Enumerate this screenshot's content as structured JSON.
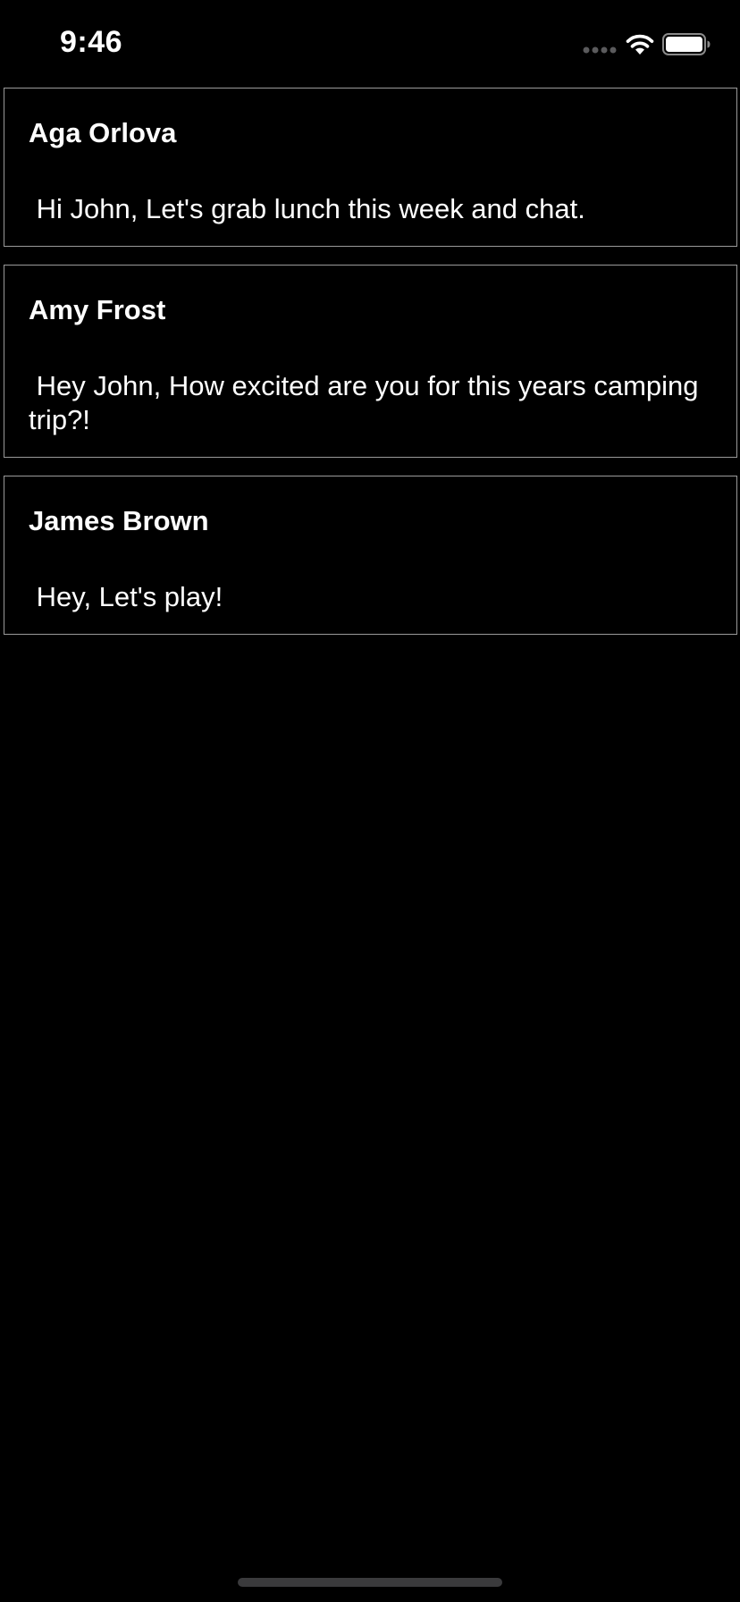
{
  "status_bar": {
    "time": "9:46",
    "icons": [
      "signal-icon",
      "wifi-icon",
      "battery-icon"
    ]
  },
  "messages": [
    {
      "sender": "Aga Orlova",
      "text": " Hi John, Let's grab lunch this week and chat."
    },
    {
      "sender": "Amy Frost",
      "text": " Hey John, How excited are you for this years camping trip?!"
    },
    {
      "sender": "James Brown",
      "text": " Hey, Let's play!"
    }
  ],
  "colors": {
    "background": "#000000",
    "text": "#ffffff",
    "card_border": "#9a9a9a",
    "home_indicator": "#3a3a3c"
  }
}
